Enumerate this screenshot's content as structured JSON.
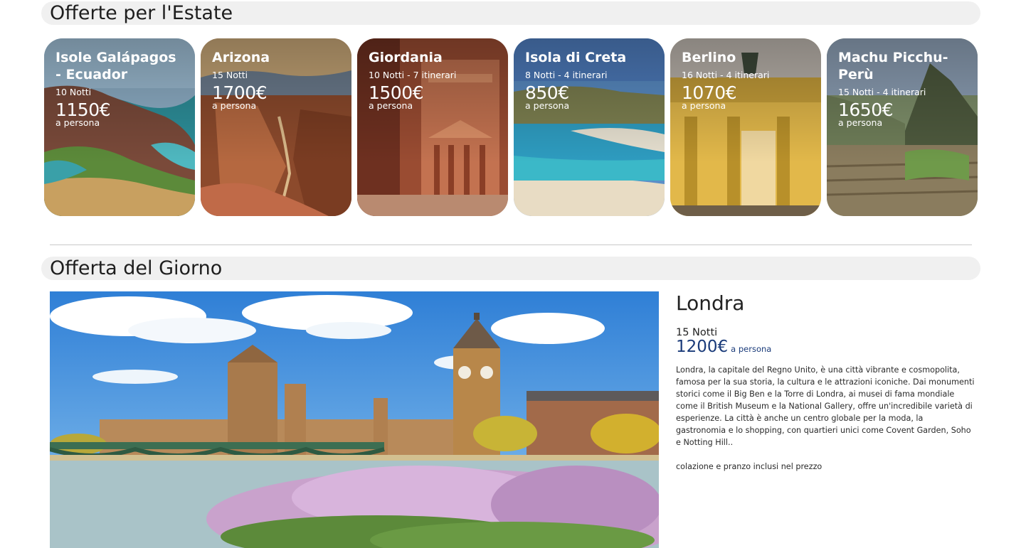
{
  "summer": {
    "title": "Offerte per l'Estate",
    "cards": [
      {
        "name": "Isole Galápagos - Ecuador",
        "nights": "10 Notti",
        "price": "1150€",
        "per": "a persona"
      },
      {
        "name": "Arizona",
        "nights": "15 Notti",
        "price": "1700€",
        "per": "a persona"
      },
      {
        "name": "Giordania",
        "nights": "10 Notti - 7 itinerari",
        "price": "1500€",
        "per": "a persona"
      },
      {
        "name": "Isola di Creta",
        "nights": "8 Notti - 4 itinerari",
        "price": "850€",
        "per": "a persona"
      },
      {
        "name": "Berlino",
        "nights": "16 Notti - 4 itinerari",
        "price": "1070€",
        "per": "a persona"
      },
      {
        "name": "Machu Picchu- Perù",
        "nights": "15 Notti - 4 itinerari",
        "price": "1650€",
        "per": "a persona"
      }
    ]
  },
  "daily": {
    "title": "Offerta del Giorno",
    "city": "Londra",
    "nights": "15 Notti",
    "price": "1200€",
    "per": "a persona",
    "description": "Londra, la capitale del Regno Unito, è una città vibrante e cosmopolita, famosa per la sua storia, la cultura e le attrazioni iconiche. Dai monumenti storici come il Big Ben e la Torre di Londra, ai musei di fama mondiale come il British Museum e la National Gallery, offre un'incredibile varietà di esperienze. La città è anche un centro globale per la moda, la gastronomia e lo shopping, con quartieri unici come Covent Garden, Soho e Notting Hill..",
    "extra": "colazione e pranzo inclusi nel prezzo"
  },
  "colors": {
    "section_bg": "#f0f0f0",
    "price_blue": "#1a3b7a",
    "divider": "#c9c9c9"
  }
}
